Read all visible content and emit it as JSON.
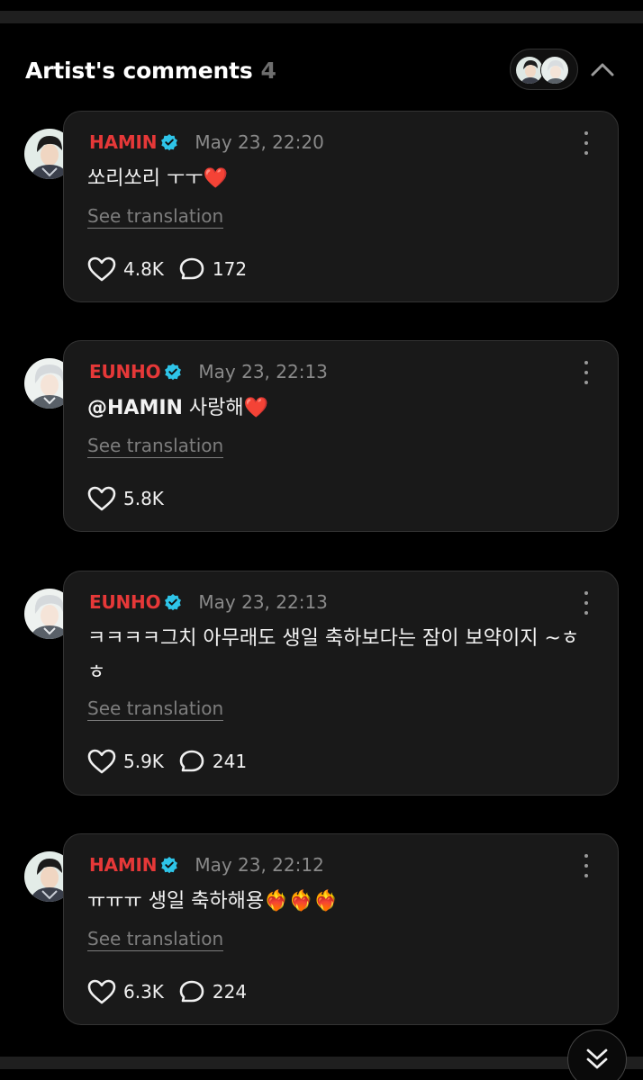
{
  "header": {
    "title": "Artist's comments",
    "count": "4"
  },
  "icons": {
    "collapse": "chevron-up-icon",
    "verified": "verified-badge-icon",
    "like": "heart-icon",
    "reply": "speech-bubble-icon",
    "more": "more-vertical-icon",
    "scroll": "double-chevron-down-icon"
  },
  "colors": {
    "background": "#000000",
    "card": "#191919",
    "author": "#e63838",
    "verified": "#2ec4e8",
    "muted": "#8a8a8a"
  },
  "comments": [
    {
      "author": "HAMIN",
      "time": "May 23, 22:20",
      "text": "쏘리쏘리 ㅜㅜ",
      "emoji": "❤️",
      "translate_label": "See translation",
      "likes": "4.8K",
      "replies": "172"
    },
    {
      "author": "EUNHO",
      "time": "May 23, 22:13",
      "mention": "@HAMIN",
      "text": " 사랑해",
      "emoji": "❤️",
      "translate_label": "See translation",
      "likes": "5.8K"
    },
    {
      "author": "EUNHO",
      "time": "May 23, 22:13",
      "text": "ㅋㅋㅋㅋ그치 아무래도 생일 축하보다는 잠이 보약이지 ~ㅎㅎ",
      "translate_label": "See translation",
      "likes": "5.9K",
      "replies": "241"
    },
    {
      "author": "HAMIN",
      "time": "May 23, 22:12",
      "text": "ㅠㅠㅠ 생일 축하해용",
      "emoji": "❤️‍🔥❤️‍🔥❤️‍🔥",
      "translate_label": "See translation",
      "likes": "6.3K",
      "replies": "224"
    }
  ]
}
